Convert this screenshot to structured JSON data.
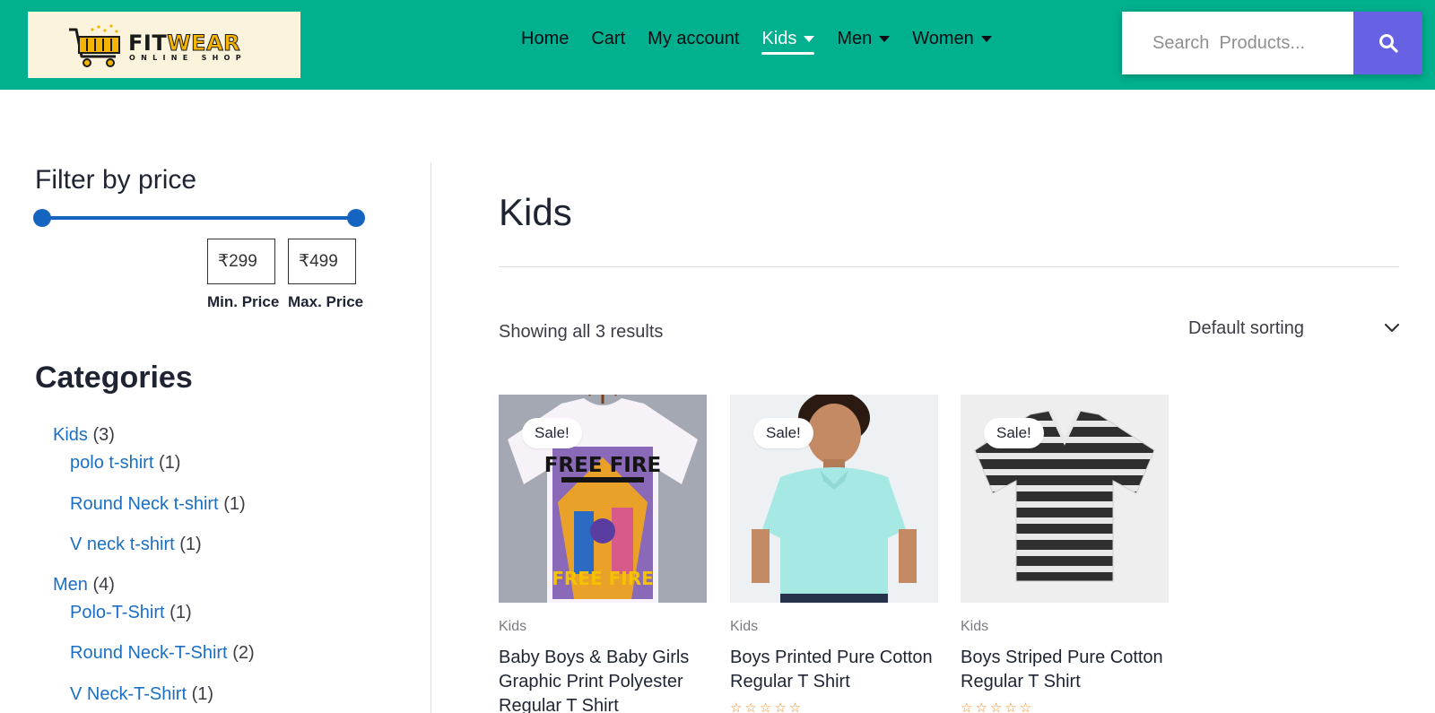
{
  "header": {
    "logo": {
      "word_part1": "FIT",
      "word_part2": "WEAR",
      "subtitle": "ONLINE SHOP"
    },
    "nav": [
      {
        "label": "Home",
        "active": false,
        "has_dropdown": false
      },
      {
        "label": "Cart",
        "active": false,
        "has_dropdown": false
      },
      {
        "label": "My account",
        "active": false,
        "has_dropdown": false
      },
      {
        "label": "Kids",
        "active": true,
        "has_dropdown": true
      },
      {
        "label": "Men",
        "active": false,
        "has_dropdown": true
      },
      {
        "label": "Women",
        "active": false,
        "has_dropdown": true
      }
    ],
    "search": {
      "placeholder": "Search  Products...",
      "value": ""
    }
  },
  "sidebar": {
    "filter": {
      "title": "Filter by price",
      "min_value": "₹299",
      "max_value": "₹499",
      "min_label": "Min. Price",
      "max_label": "Max. Price"
    },
    "categories": {
      "title": "Categories",
      "items": [
        {
          "label": "Kids",
          "count": "(3)",
          "level": 0
        },
        {
          "label": "polo t-shirt",
          "count": "(1)",
          "level": 1
        },
        {
          "label": "Round Neck t-shirt",
          "count": "(1)",
          "level": 1
        },
        {
          "label": "V neck t-shirt",
          "count": "(1)",
          "level": 1
        },
        {
          "label": "Men",
          "count": "(4)",
          "level": 0
        },
        {
          "label": "Polo-T-Shirt",
          "count": "(1)",
          "level": 1
        },
        {
          "label": "Round Neck-T-Shirt",
          "count": "(2)",
          "level": 1
        },
        {
          "label": "V Neck-T-Shirt",
          "count": "(1)",
          "level": 1
        }
      ]
    }
  },
  "main": {
    "title": "Kids",
    "result_count": "Showing all 3 results",
    "sort_label": "Default sorting",
    "products": [
      {
        "badge": "Sale!",
        "category": "Kids",
        "title": "Baby Boys & Baby Girls Graphic Print Polyester Regular T Shirt",
        "rating": 0,
        "image_text": "FREE FIRE"
      },
      {
        "badge": "Sale!",
        "category": "Kids",
        "title": "Boys Printed Pure Cotton Regular T Shirt",
        "rating": 0
      },
      {
        "badge": "Sale!",
        "category": "Kids",
        "title": "Boys Striped Pure Cotton Regular T Shirt",
        "rating": 0
      }
    ]
  },
  "colors": {
    "header_bg": "#00b08e",
    "search_button": "#6761e3",
    "link": "#1a6fc4",
    "slider": "#1565c0",
    "star": "#f28a22"
  },
  "icons": {
    "search": "search-icon",
    "cart_logo": "shopping-cart-icon",
    "sort": "chevron-down-icon",
    "nav_dropdown": "caret-down-icon"
  }
}
